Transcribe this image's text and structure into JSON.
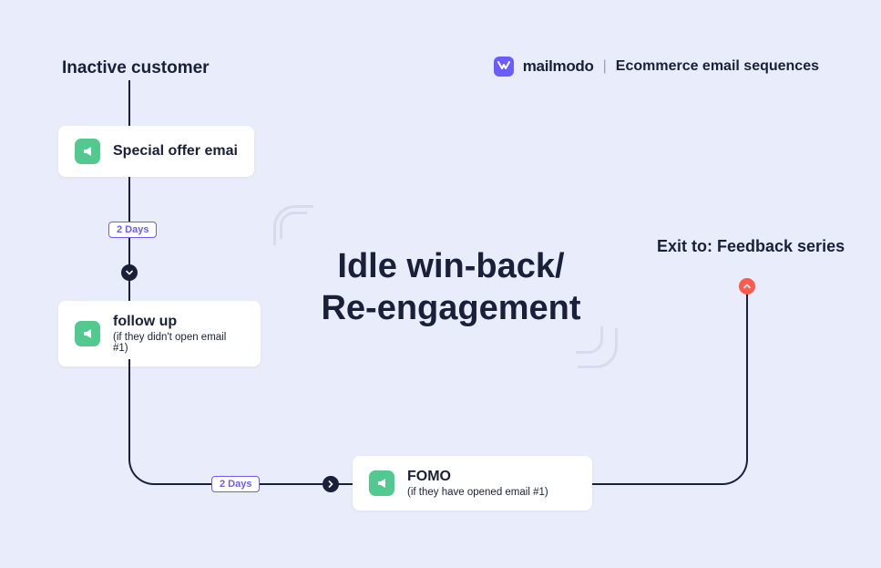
{
  "header": {
    "start_label": "Inactive customer"
  },
  "brand": {
    "name": "mailmodo",
    "subtitle": "Ecommerce email sequences"
  },
  "title": {
    "line1": "Idle win-back/",
    "line2": "Re-engagement"
  },
  "exit": {
    "label": "Exit to: Feedback series"
  },
  "delays": {
    "d1": "2 Days",
    "d2": "2 Days"
  },
  "cards": {
    "c1": {
      "title": "Special offer emai"
    },
    "c2": {
      "title": "follow up",
      "sub": "(if they didn't open email #1)"
    },
    "c3": {
      "title": "FOMO",
      "sub": "(if they have opened email #1)"
    }
  }
}
